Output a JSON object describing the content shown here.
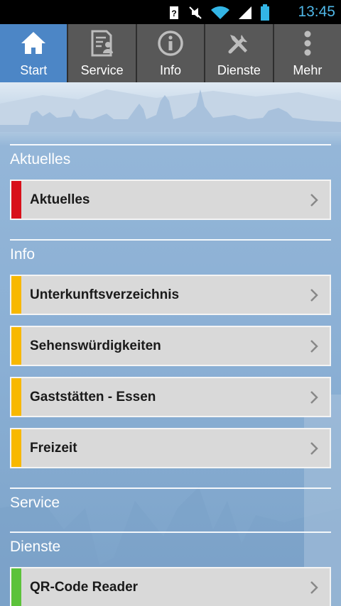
{
  "statusbar": {
    "time": "13:45"
  },
  "tabs": [
    {
      "label": "Start",
      "icon": "home-icon",
      "active": true
    },
    {
      "label": "Service",
      "icon": "document-person-icon",
      "active": false
    },
    {
      "label": "Info",
      "icon": "info-icon",
      "active": false
    },
    {
      "label": "Dienste",
      "icon": "tools-icon",
      "active": false
    },
    {
      "label": "Mehr",
      "icon": "more-vertical-icon",
      "active": false
    }
  ],
  "sections": {
    "aktuelles": {
      "title": "Aktuelles",
      "items": [
        {
          "label": "Aktuelles",
          "color": "#d8101a"
        }
      ]
    },
    "info": {
      "title": "Info",
      "items": [
        {
          "label": "Unterkunftsverzeichnis",
          "color": "#f8b800"
        },
        {
          "label": "Sehenswürdigkeiten",
          "color": "#f8b800"
        },
        {
          "label": "Gaststätten - Essen",
          "color": "#f8b800"
        },
        {
          "label": "Freizeit",
          "color": "#f8b800"
        }
      ]
    },
    "service": {
      "title": "Service"
    },
    "dienste": {
      "title": "Dienste",
      "items": [
        {
          "label": "QR-Code Reader",
          "color": "#5cc23a"
        }
      ]
    }
  }
}
